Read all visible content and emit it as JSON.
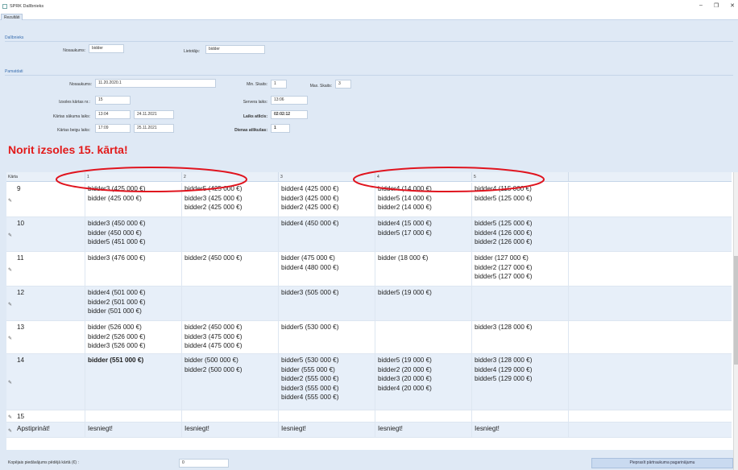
{
  "window": {
    "title": "SPRK Dalībnieks"
  },
  "tabs": [
    {
      "label": "Rezultāti"
    }
  ],
  "participant": {
    "section_title": "Dalībnieks",
    "name_label": "Nosaukums:",
    "name_value": "bidder",
    "user_label": "Lietotājs:",
    "user_value": "bidder"
  },
  "basic": {
    "section_title": "Pamatdati",
    "name_label": "Nosaukums:",
    "name_value": "11.20.2020.1",
    "min_label": "Min. Skaits:",
    "min_value": "1",
    "max_label": "Max. Skaits:",
    "max_value": "3",
    "round_no_label": "Izsoles kārtas nr.:",
    "round_no_value": "15",
    "server_time_label": "Servera laiks:",
    "server_time_value": "13:06",
    "round_start_label": "Kārtas sākuma laiks:",
    "round_start_time": "13:04",
    "round_start_date": "24.11.2021",
    "time_left_label": "Laiks atlicis:",
    "time_left_value": "02:02:12",
    "round_end_label": "Kārtas beigu laiks:",
    "round_end_time": "17:09",
    "round_end_date": "25.11.2021",
    "day_postpone_label": "Dienas atlikušas:",
    "day_postpone_value": "1"
  },
  "status_message": "Norit izsoles 15. kārta!",
  "grid": {
    "columns": [
      "Kārta",
      "1",
      "2",
      "3",
      "4",
      "5"
    ],
    "rows": [
      {
        "round": "9",
        "cells": [
          [
            "bidder3 (425 000 €)",
            "bidder (425 000 €)"
          ],
          [
            "bidder5 (425 000 €)",
            "bidder3 (425 000 €)",
            "bidder2 (425 000 €)"
          ],
          [
            "bidder4 (425 000 €)",
            "bidder3 (425 000 €)",
            "bidder2 (425 000 €)"
          ],
          [
            "bidder4 (14 000 €)",
            "bidder5 (14 000 €)",
            "bidder2 (14 000 €)"
          ],
          [
            "bidder4 (115 000 €)",
            "bidder5 (125 000 €)"
          ]
        ]
      },
      {
        "round": "10",
        "cells": [
          [
            "bidder3 (450 000 €)",
            "bidder (450 000 €)",
            "bidder5 (451 000 €)"
          ],
          [],
          [
            "bidder4 (450 000 €)"
          ],
          [
            "bidder4 (15 000 €)",
            "bidder5 (17 000 €)"
          ],
          [
            "bidder5 (125 000 €)",
            "bidder4 (126 000 €)",
            "bidder2 (126 000 €)"
          ]
        ]
      },
      {
        "round": "11",
        "cells": [
          [
            "bidder3 (476 000 €)"
          ],
          [
            "bidder2 (450 000 €)"
          ],
          [
            "bidder (475 000 €)",
            "bidder4 (480 000 €)"
          ],
          [
            "bidder (18 000 €)"
          ],
          [
            "bidder (127 000 €)",
            "bidder2 (127 000 €)",
            "bidder5 (127 000 €)"
          ]
        ]
      },
      {
        "round": "12",
        "cells": [
          [
            "bidder4 (501 000 €)",
            "bidder2 (501 000 €)",
            "bidder (501 000 €)"
          ],
          [],
          [
            "bidder3 (505 000 €)"
          ],
          [
            "bidder5 (19 000 €)"
          ],
          []
        ]
      },
      {
        "round": "13",
        "cells": [
          [
            "bidder (526 000 €)",
            "bidder2 (526 000 €)",
            "bidder3 (526 000 €)"
          ],
          [
            "bidder2 (450 000 €)",
            "bidder3 (475 000 €)",
            "bidder4 (475 000 €)"
          ],
          [
            "bidder5 (530 000 €)"
          ],
          [],
          [
            "bidder3 (128 000 €)"
          ]
        ]
      },
      {
        "round": "14",
        "cells": [
          [
            "bidder (551 000 €)"
          ],
          [
            "bidder (500 000 €)",
            "bidder2 (500 000 €)"
          ],
          [
            "bidder5 (530 000 €)",
            "bidder (555 000 €)",
            "bidder2 (555 000 €)",
            "bidder3 (555 000 €)",
            "bidder4 (555 000 €)"
          ],
          [
            "bidder5 (19 000 €)",
            "bidder2 (20 000 €)",
            "bidder3 (20 000 €)",
            "bidder4 (20 000 €)"
          ],
          [
            "bidder3 (128 000 €)",
            "bidder4 (129 000 €)",
            "bidder5 (129 000 €)"
          ]
        ]
      },
      {
        "round": "15",
        "cells": [
          [],
          [],
          [],
          [],
          []
        ]
      },
      {
        "round": "Apstiprināt!",
        "cells": [
          [
            "Iesniegt!"
          ],
          [
            "Iesniegt!"
          ],
          [
            "Iesniegt!"
          ],
          [
            "Iesniegt!"
          ],
          [
            "Iesniegt!"
          ]
        ]
      }
    ],
    "bold_cell": {
      "row": 5,
      "col": 0
    }
  },
  "footer": {
    "total_label": "Kopējais piedāvājums pēdējā kārtā (€) :",
    "total_value": "0",
    "request_button": "Pieprasīt pārtraukuma pagarinājumu"
  },
  "annotation_color": "#e0141e"
}
